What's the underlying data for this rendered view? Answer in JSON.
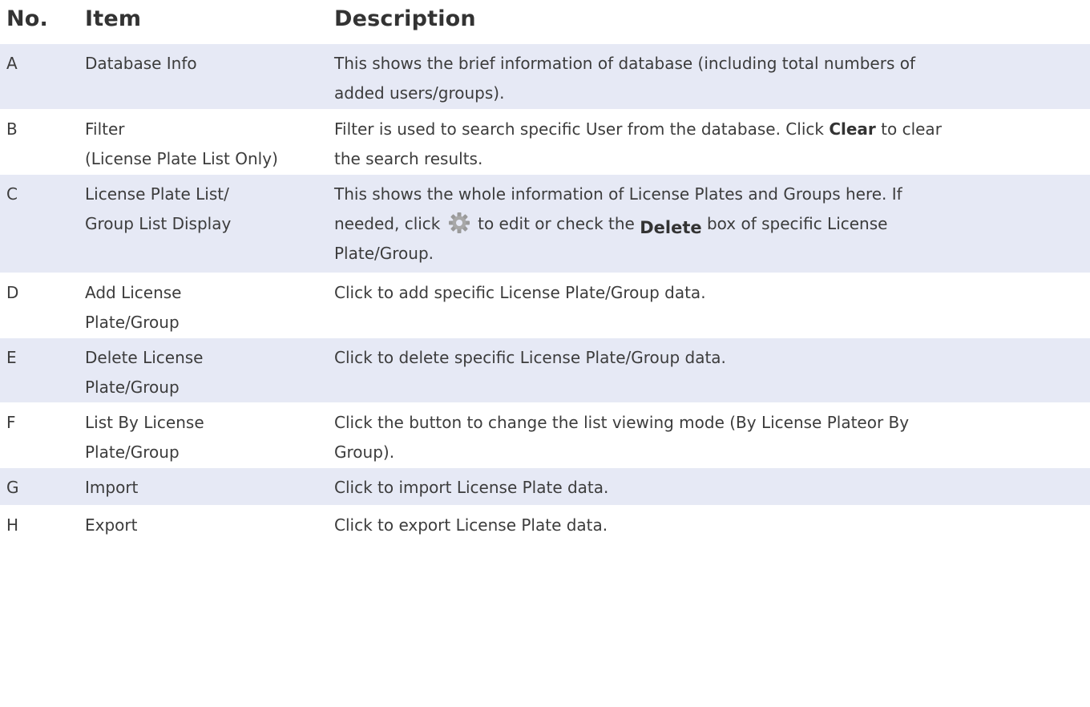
{
  "header": {
    "no": "No.",
    "item": "Item",
    "description": "Description"
  },
  "rows": [
    {
      "no": "A",
      "item": [
        "Database Info"
      ],
      "desc": [
        "This shows the brief information of database (including total numbers of",
        "added users/groups)."
      ]
    },
    {
      "no": "B",
      "item": [
        "Filter",
        "(License Plate List Only)"
      ],
      "desc_line1_a": "Filter is used to search specific User from the database. Click ",
      "desc_line1_bold": "Clear",
      "desc_line1_b": " to clear",
      "desc_line2": "the search results."
    },
    {
      "no": "C",
      "item": [
        "License Plate List/",
        "Group List Display"
      ],
      "desc_line1": "This shows the whole information of License Plates and Groups here. If",
      "desc_line2_a": "needed, click ",
      "desc_line2_icon": "gear-icon",
      "desc_line2_b": " to edit or check the ",
      "desc_line2_button": "Delete",
      "desc_line2_c": " box of specific License",
      "desc_line3": "Plate/Group."
    },
    {
      "no": "D",
      "item": [
        "Add License",
        "Plate/Group"
      ],
      "desc": [
        "Click to add specific License Plate/Group data."
      ]
    },
    {
      "no": "E",
      "item": [
        "Delete License",
        "Plate/Group"
      ],
      "desc": [
        "Click to delete specific License Plate/Group data."
      ]
    },
    {
      "no": "F",
      "item": [
        "List By License",
        "Plate/Group"
      ],
      "desc": [
        "Click the button to change the list viewing mode (By License Plateor By",
        "Group)."
      ]
    },
    {
      "no": "G",
      "item": [
        "Import"
      ],
      "desc": [
        "Click to import License Plate data."
      ]
    },
    {
      "no": "H",
      "item": [
        "Export"
      ],
      "desc": [
        "Click to export License Plate data."
      ]
    }
  ],
  "colors": {
    "row_shade": "#e6e9f5",
    "text": "#3c3c3c",
    "header_text": "#333333"
  }
}
